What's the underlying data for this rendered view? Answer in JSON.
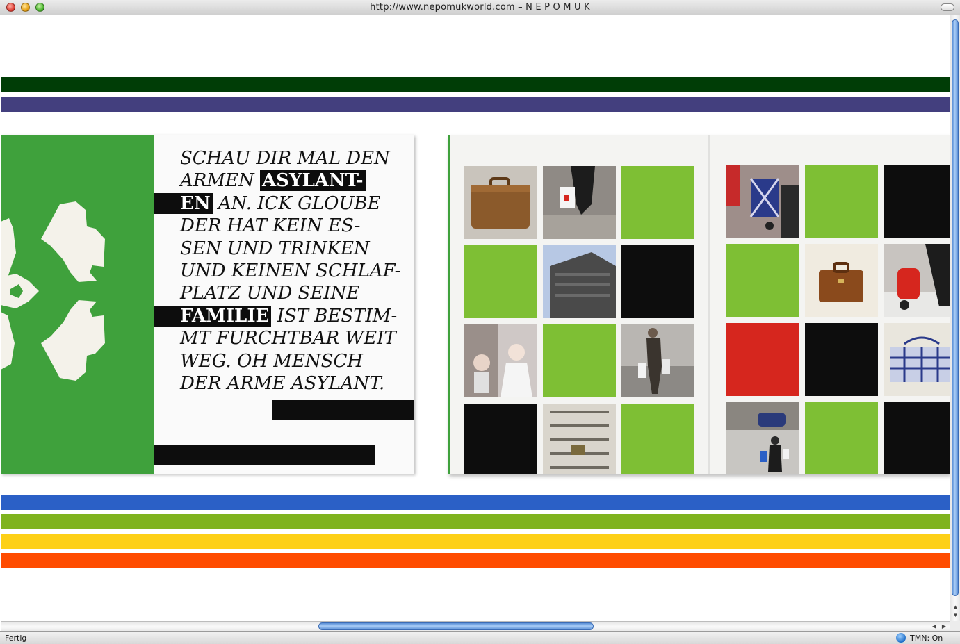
{
  "window": {
    "title": "http://www.nepomukworld.com – N E P O M U K"
  },
  "status": {
    "text": "Fertig",
    "tmn": "TMN: On"
  },
  "colors": {
    "dark_green": "#003d06",
    "purple": "#433f7e",
    "blue": "#2b60c6",
    "lime": "#7fb31e",
    "yellow": "#fdd017",
    "orange": "#ff4c00",
    "tile_green": "#7ebf34",
    "tile_red": "#d6261e",
    "tile_black": "#0d0d0d",
    "cover_green": "#3fa13c"
  },
  "poem": {
    "lines": [
      {
        "before": "SCHAU DIR MAL DEN",
        "highlight": "",
        "after": ""
      },
      {
        "before": "ARMEN ",
        "highlight": "ASYLANT-",
        "after": ""
      },
      {
        "before": "",
        "highlight": "EN",
        "after": " AN. ICK GLOUBE"
      },
      {
        "before": "DER HAT KEIN ES-",
        "highlight": "",
        "after": ""
      },
      {
        "before": "SEN UND TRINKEN",
        "highlight": "",
        "after": ""
      },
      {
        "before": "UND KEINEN SCHLAF-",
        "highlight": "",
        "after": ""
      },
      {
        "before": "PLATZ UND SEINE",
        "highlight": "",
        "after": ""
      },
      {
        "before": "",
        "highlight": "FAMILIE",
        "after": " IST BESTIM-"
      },
      {
        "before": "MT FURCHTBAR WEIT",
        "highlight": "",
        "after": ""
      },
      {
        "before": "WEG. OH MENSCH",
        "highlight": "",
        "after": ""
      },
      {
        "before": "DER ARME ASYLANT.",
        "highlight": "",
        "after": ""
      }
    ]
  },
  "grid_left": [
    "photo-suitcase",
    "photo-legs-bag",
    "green",
    "green",
    "photo-building",
    "black",
    "photo-portraits",
    "green",
    "photo-man-bags",
    "black",
    "photo-apartments",
    "green"
  ],
  "grid_right": [
    "photo-trolley",
    "green",
    "black",
    "green",
    "photo-briefcase",
    "photo-red-trolley",
    "red",
    "black",
    "photo-checked-bag",
    "photo-street",
    "green",
    "black"
  ]
}
